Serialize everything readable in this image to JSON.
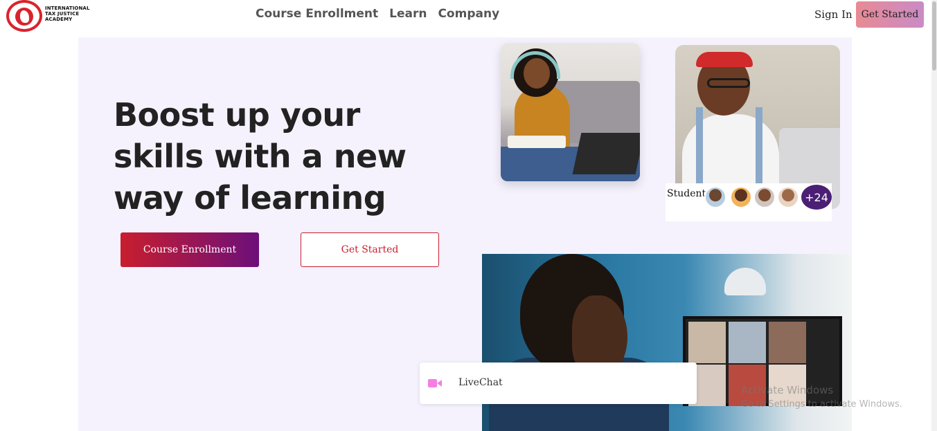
{
  "brand": {
    "logo_text": "INTERNATIONAL TAX JUSTICE ACADEMY",
    "accent_color": "#d9232d"
  },
  "nav": {
    "items": [
      {
        "label": "Course Enrollment"
      },
      {
        "label": "Learn"
      },
      {
        "label": "Company"
      }
    ],
    "sign_in": "Sign In",
    "cta": "Get Started"
  },
  "hero": {
    "headline": "Boost up your skills with a new way of learning",
    "primary_button": "Course Enrollment",
    "secondary_button": "Get Started",
    "background_color": "#f5f2fd"
  },
  "students": {
    "label": "Students",
    "more_count": "+24",
    "badge_color": "#4b1f74"
  },
  "livechat": {
    "label": "LiveChat",
    "icon": "video-camera-icon",
    "icon_color": "#f47fe0"
  },
  "watermark": {
    "line1": "Activate Windows",
    "line2": "Go to Settings to activate Windows."
  }
}
